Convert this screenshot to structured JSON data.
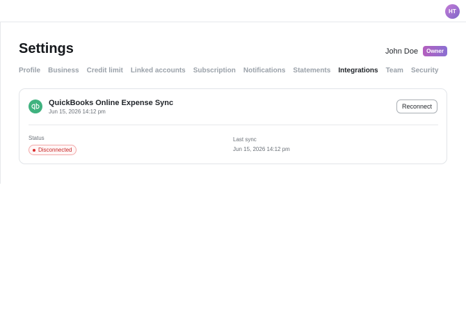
{
  "header": {
    "avatar_initials": "HT"
  },
  "page": {
    "title": "Settings"
  },
  "user": {
    "name": "John Doe",
    "role": "Owner"
  },
  "tabs": [
    {
      "label": "Profile",
      "active": false
    },
    {
      "label": "Business",
      "active": false
    },
    {
      "label": "Credit limit",
      "active": false
    },
    {
      "label": "Linked accounts",
      "active": false
    },
    {
      "label": "Subscription",
      "active": false
    },
    {
      "label": "Notifications",
      "active": false
    },
    {
      "label": "Statements",
      "active": false
    },
    {
      "label": "Integrations",
      "active": true
    },
    {
      "label": "Team",
      "active": false
    },
    {
      "label": "Security",
      "active": false
    }
  ],
  "integration": {
    "icon": "quickbooks-logo",
    "name": "QuickBooks Online Expense Sync",
    "date": "Jun 15, 2026 14:12 pm",
    "reconnect_label": "Reconnect",
    "status_label": "Status",
    "status_value": "Disconnected",
    "last_sync_label": "Last sync",
    "last_sync_value": "Jun 15, 2026 14:12 pm"
  },
  "colors": {
    "brand_logo": "#3fb27f",
    "role_badge": "#a066c8",
    "status_error": "#c62828"
  }
}
